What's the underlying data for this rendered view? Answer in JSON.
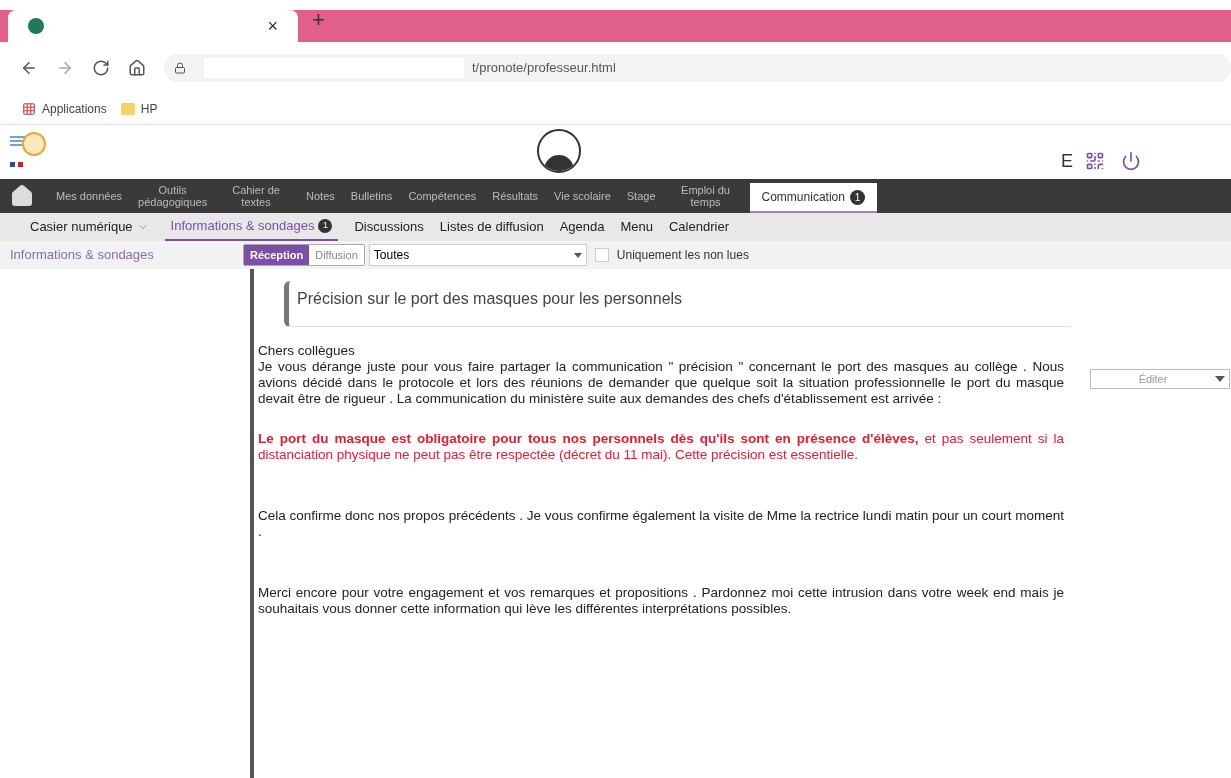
{
  "browser": {
    "tab_close": "×",
    "new_tab": "+",
    "url": "t/pronote/professeur.html",
    "bookmarks": [
      "Applications",
      "HP"
    ]
  },
  "header": {
    "user_initial": "E"
  },
  "nav": {
    "items": [
      {
        "label": "Mes données",
        "selected": false
      },
      {
        "label": "Outils pédagogiques",
        "selected": false
      },
      {
        "label": "Cahier de textes",
        "selected": false
      },
      {
        "label": "Notes",
        "selected": false
      },
      {
        "label": "Bulletins",
        "selected": false
      },
      {
        "label": "Compétences",
        "selected": false
      },
      {
        "label": "Résultats",
        "selected": false
      },
      {
        "label": "Vie scolaire",
        "selected": false
      },
      {
        "label": "Stage",
        "selected": false
      },
      {
        "label": "Emploi du temps",
        "selected": false
      },
      {
        "label": "Communication",
        "selected": true,
        "badge": "1"
      }
    ]
  },
  "subnav": {
    "items": [
      {
        "label": "Casier numérique",
        "selected": false,
        "dropdown": true
      },
      {
        "label": "Informations & sondages",
        "selected": true,
        "badge": "1"
      },
      {
        "label": "Discussions",
        "selected": false
      },
      {
        "label": "Listes de diffusion",
        "selected": false
      },
      {
        "label": "Agenda",
        "selected": false
      },
      {
        "label": "Menu",
        "selected": false
      },
      {
        "label": "Calendrier",
        "selected": false
      }
    ]
  },
  "toolbar": {
    "section_title": "Informations & sondages",
    "modes": [
      {
        "label": "Réception",
        "selected": true
      },
      {
        "label": "Diffusion",
        "selected": false
      }
    ],
    "filter": "Toutes",
    "unread_only": {
      "label": "Uniquement les non lues",
      "checked": false
    }
  },
  "message": {
    "title": "Précision sur le port des masques pour les personnels",
    "edit_button": "Éditer",
    "paragraphs": [
      {
        "kind": "normal",
        "text": "Chers collègues"
      },
      {
        "kind": "normal",
        "text": "Je vous dérange juste pour vous faire partager la communication \" précision \" concernant le port des masques au collège . Nous avions décidé dans le protocole et lors des réunions de demander que quelque soit la situation professionnelle  le port du masque devait être de rigueur . La communication du ministère suite aux demandes des chefs d'établissement est arrivée :"
      },
      {
        "kind": "alert",
        "text": "**Le port du masque est obligatoire pour tous nos personnels dès qu'ils sont  en présence d'élèves,** et pas seulement si la distanciation physique ne peut pas être respectée (décret du 11 mai). Cette précision est essentielle."
      },
      {
        "kind": "normal",
        "text": "Cela confirme donc nos propos précédents . Je vous confirme également la visite de Mme la rectrice lundi matin pour un court moment ."
      },
      {
        "kind": "normal",
        "text": " Merci encore pour votre engagement et vos remarques et propositions . Pardonnez moi cette intrusion dans votre week end mais je souhaitais vous donner cette information qui lève les différentes interprétations possibles."
      }
    ]
  }
}
